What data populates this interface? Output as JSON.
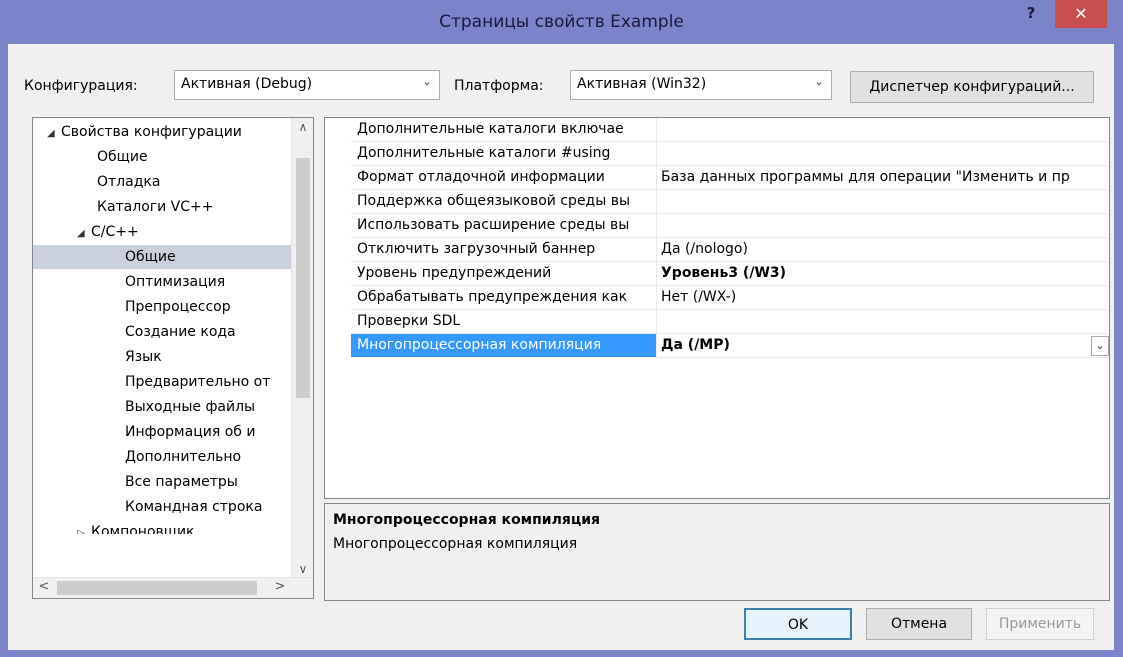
{
  "window": {
    "title": "Страницы свойств Example",
    "help": "?",
    "close": "✕"
  },
  "toolbar": {
    "config_label": "Конфигурация:",
    "config_value": "Активная (Debug)",
    "platform_label": "Платформа:",
    "platform_value": "Активная (Win32)",
    "config_manager": "Диспетчер конфигураций...",
    "arrow": "⌄"
  },
  "tree": {
    "items": [
      {
        "label": "Свойства конфигурации",
        "expander": "◢"
      },
      {
        "label": "Общие"
      },
      {
        "label": "Отладка"
      },
      {
        "label": "Каталоги VC++"
      },
      {
        "label": "C/C++",
        "expander": "◢"
      },
      {
        "label": "Общие"
      },
      {
        "label": "Оптимизация"
      },
      {
        "label": "Препроцессор"
      },
      {
        "label": "Создание кода"
      },
      {
        "label": "Язык"
      },
      {
        "label": "Предварительно от"
      },
      {
        "label": "Выходные файлы"
      },
      {
        "label": "Информация об и"
      },
      {
        "label": "Дополнительно"
      },
      {
        "label": "Все параметры"
      },
      {
        "label": "Командная строка"
      },
      {
        "label": "Компоновщик",
        "expander": "▷"
      }
    ],
    "scroll_up": "∧",
    "scroll_down": "∨",
    "scroll_left": "<",
    "scroll_right": ">"
  },
  "grid": {
    "rows": [
      {
        "name": "Дополнительные каталоги включае",
        "value": ""
      },
      {
        "name": "Дополнительные каталоги #using",
        "value": ""
      },
      {
        "name": "Формат отладочной информации",
        "value": "База данных программы для операции \"Изменить и пр"
      },
      {
        "name": "Поддержка общеязыковой среды вы",
        "value": ""
      },
      {
        "name": "Использовать расширение среды вы",
        "value": ""
      },
      {
        "name": "Отключить загрузочный баннер",
        "value": "Да (/nologo)"
      },
      {
        "name": "Уровень предупреждений",
        "value": "Уровень3 (/W3)"
      },
      {
        "name": "Обрабатывать предупреждения как",
        "value": "Нет (/WX-)"
      },
      {
        "name": "Проверки SDL",
        "value": ""
      },
      {
        "name": "Многопроцессорная компиляция",
        "value": "Да (/MP)"
      }
    ],
    "dropdown": "⌄"
  },
  "description": {
    "title": "Многопроцессорная компиляция",
    "text": "Многопроцессорная компиляция"
  },
  "buttons": {
    "ok": "OK",
    "cancel": "Отмена",
    "apply": "Применить"
  }
}
